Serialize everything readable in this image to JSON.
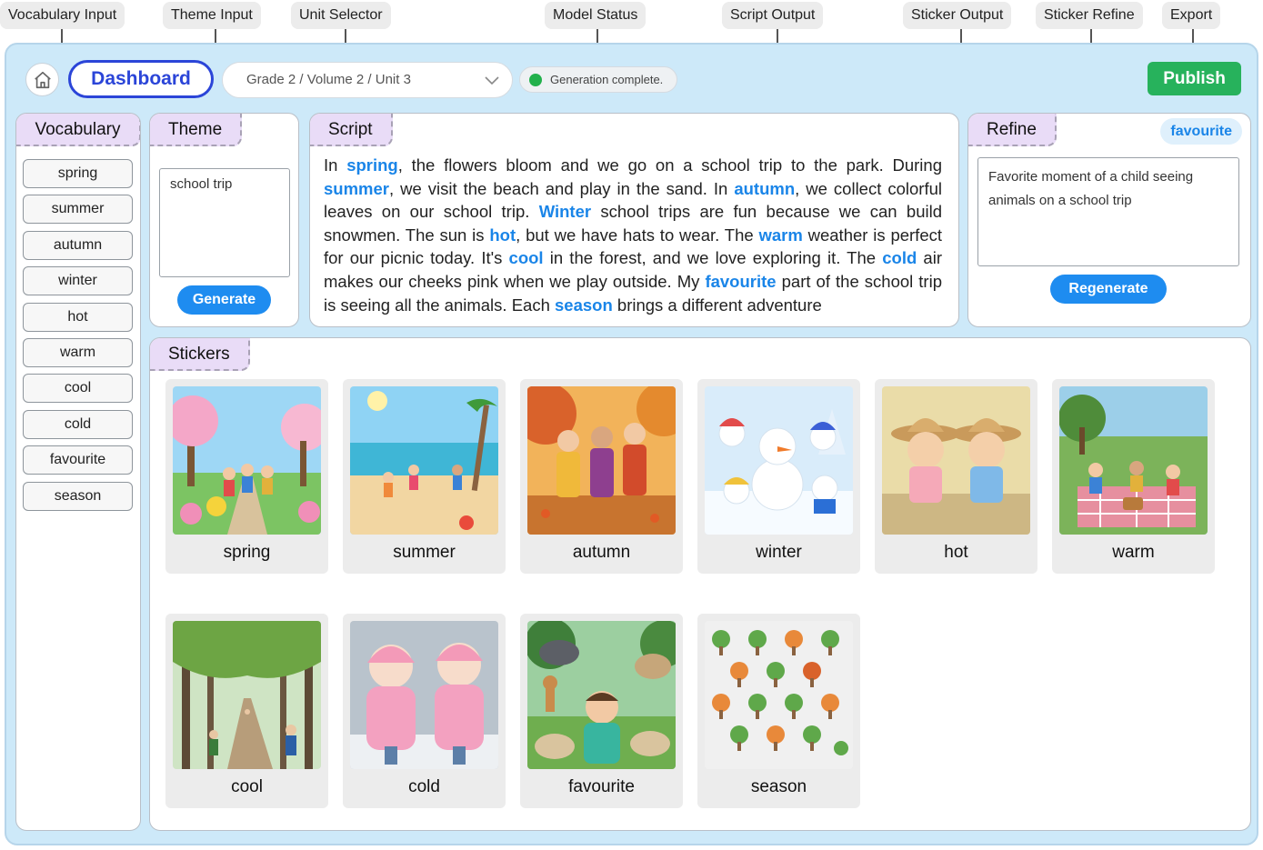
{
  "annotations": [
    "Vocabulary Input",
    "Theme Input",
    "Unit Selector",
    "Model Status",
    "Script Output",
    "Sticker Output",
    "Sticker Refine",
    "Export"
  ],
  "header": {
    "dashboard_label": "Dashboard",
    "unit_selector": "Grade 2 / Volume 2 / Unit 3",
    "status_text": "Generation complete.",
    "status_color": "#22b14c",
    "publish_label": "Publish"
  },
  "vocabulary": {
    "title": "Vocabulary",
    "items": [
      "spring",
      "summer",
      "autumn",
      "winter",
      "hot",
      "warm",
      "cool",
      "cold",
      "favourite",
      "season"
    ]
  },
  "theme": {
    "title": "Theme",
    "input_value": "school trip",
    "generate_label": "Generate"
  },
  "script": {
    "title": "Script",
    "segments": [
      {
        "t": "In ",
        "k": false
      },
      {
        "t": "spring",
        "k": true
      },
      {
        "t": ", the flowers bloom and we go on a school trip to the park. During ",
        "k": false
      },
      {
        "t": "summer",
        "k": true
      },
      {
        "t": ", we visit the beach and play in the sand. In ",
        "k": false
      },
      {
        "t": "autumn",
        "k": true
      },
      {
        "t": ", we collect colorful leaves on our school trip. ",
        "k": false
      },
      {
        "t": "Winter",
        "k": true
      },
      {
        "t": " school trips are fun because we can build snowmen. The sun is ",
        "k": false
      },
      {
        "t": "hot",
        "k": true
      },
      {
        "t": ", but we have hats to wear. The ",
        "k": false
      },
      {
        "t": "warm",
        "k": true
      },
      {
        "t": " weather is perfect for our picnic today. It's ",
        "k": false
      },
      {
        "t": "cool",
        "k": true
      },
      {
        "t": " in the forest, and we love exploring it. The ",
        "k": false
      },
      {
        "t": "cold",
        "k": true
      },
      {
        "t": " air makes our cheeks pink when we play outside. My ",
        "k": false
      },
      {
        "t": "favourite",
        "k": true
      },
      {
        "t": " part of the school trip is seeing all the animals. Each ",
        "k": false
      },
      {
        "t": "season",
        "k": true
      },
      {
        "t": " brings a different adventure",
        "k": false
      }
    ],
    "keyword_color": "#1a85e8"
  },
  "refine": {
    "title": "Refine",
    "selected_word": "favourite",
    "input_value": "Favorite moment of a child seeing animals on a school trip",
    "regenerate_label": "Regenerate"
  },
  "stickers": {
    "title": "Stickers",
    "items": [
      {
        "label": "spring",
        "scene": "spring-scene"
      },
      {
        "label": "summer",
        "scene": "summer-scene"
      },
      {
        "label": "autumn",
        "scene": "autumn-scene"
      },
      {
        "label": "winter",
        "scene": "winter-scene"
      },
      {
        "label": "hot",
        "scene": "hot-scene"
      },
      {
        "label": "warm",
        "scene": "warm-scene"
      },
      {
        "label": "cool",
        "scene": "cool-scene"
      },
      {
        "label": "cold",
        "scene": "cold-scene"
      },
      {
        "label": "favourite",
        "scene": "favourite-scene"
      },
      {
        "label": "season",
        "scene": "season-scene"
      }
    ]
  },
  "colors": {
    "frame_bg": "#cde9f9",
    "tab_bg": "#e9dcf7",
    "accent_blue": "#1e8cf0",
    "dashboard_blue": "#2b45d8",
    "publish_green": "#27b25c"
  }
}
